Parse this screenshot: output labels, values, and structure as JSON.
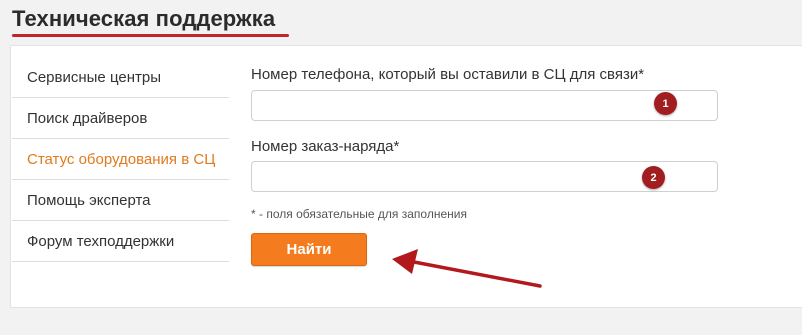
{
  "header": {
    "title": "Техническая поддержка"
  },
  "sidebar": {
    "items": [
      {
        "label": "Сервисные центры"
      },
      {
        "label": "Поиск драйверов"
      },
      {
        "label": "Статус оборудования в СЦ"
      },
      {
        "label": "Помощь эксперта"
      },
      {
        "label": "Форум техподдержки"
      }
    ],
    "active_item": "Статус оборудования в СЦ",
    "active_color": "#e07a1f"
  },
  "form": {
    "phone_label": "Номер телефона, который вы оставили в СЦ для связи*",
    "phone_value": "",
    "order_label": "Номер заказ-наряда*",
    "order_value": "",
    "required_note": "* - поля обязательные для заполнения",
    "submit_label": "Найти"
  },
  "annotations": {
    "badge_1": "1",
    "badge_2": "2",
    "badge_color": "#a11d1f",
    "arrow_color": "#b3191c"
  },
  "colors": {
    "accent": "#f47b1e",
    "title_underline": "#c0272d"
  }
}
